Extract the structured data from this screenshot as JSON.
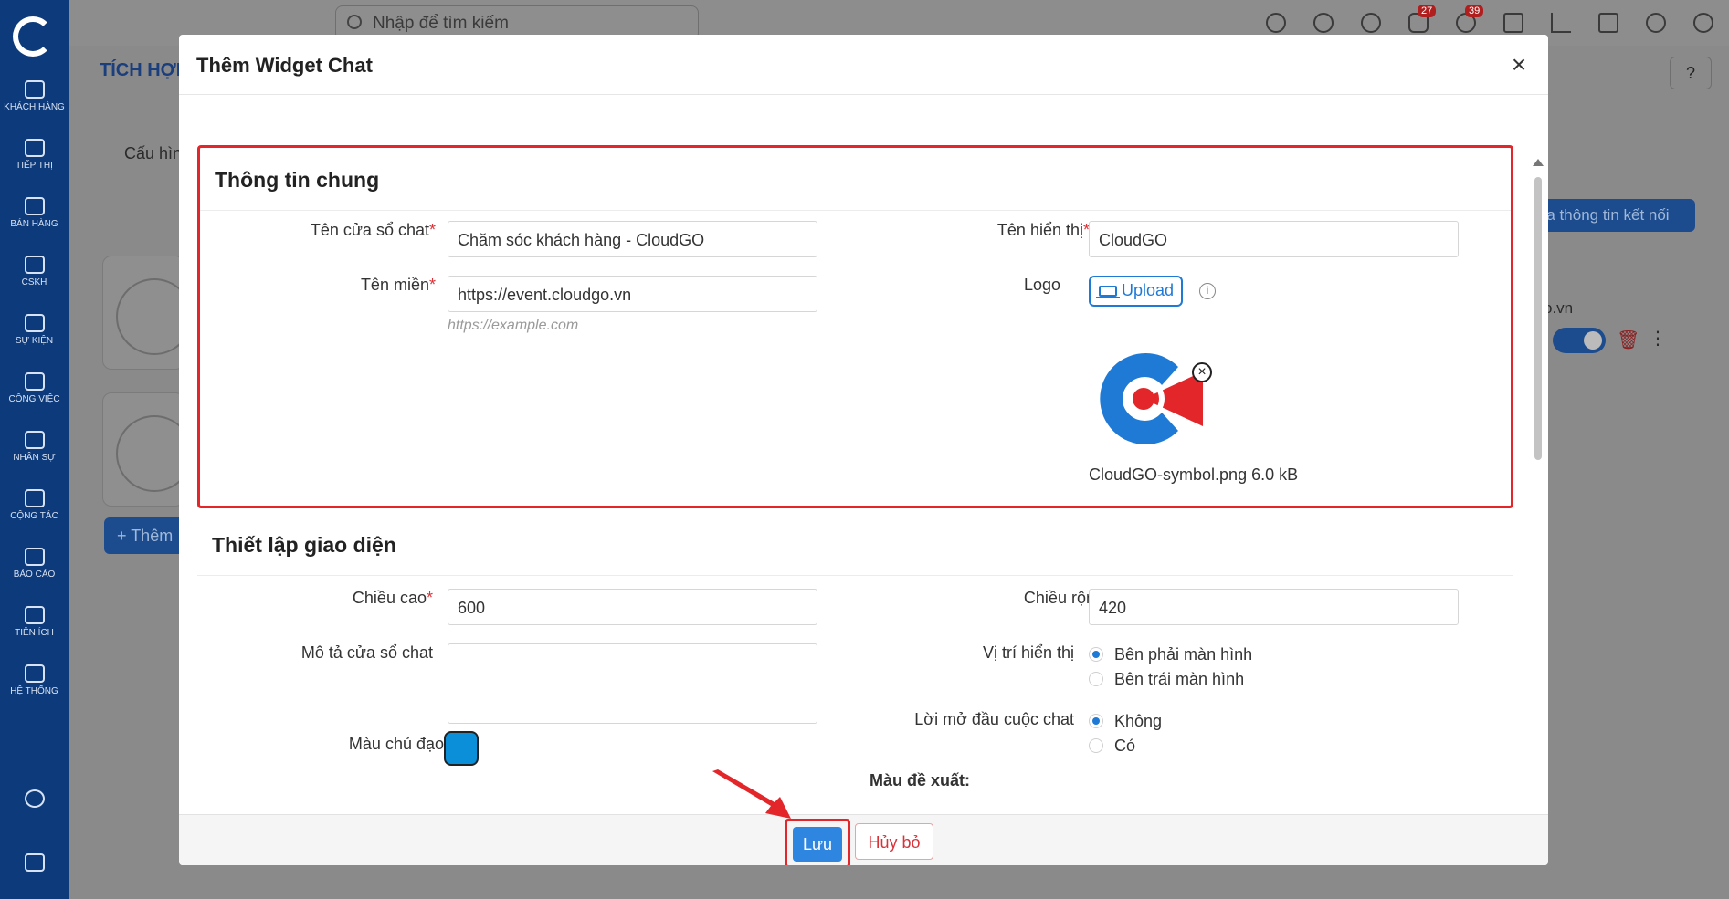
{
  "background": {
    "search_placeholder": "Nhập để tìm kiếm",
    "page_title": "TÍCH HỢP",
    "tab_label": "Cấu hìn",
    "add_button": "+ Thêm",
    "right_button": "ửa thông tin kết nối",
    "right_text": "o.vn",
    "badges": {
      "notifications": "27",
      "messages": "39"
    },
    "sidebar": [
      {
        "label": "KHÁCH HÀNG",
        "icon": "users-icon"
      },
      {
        "label": "TIẾP THỊ",
        "icon": "megaphone-icon"
      },
      {
        "label": "BÁN HÀNG",
        "icon": "cart-icon"
      },
      {
        "label": "CSKH",
        "icon": "headset-icon"
      },
      {
        "label": "SỰ KIỆN",
        "icon": "calendar-icon"
      },
      {
        "label": "CÔNG VIỆC",
        "icon": "briefcase-icon"
      },
      {
        "label": "NHÂN SỰ",
        "icon": "id-card-icon"
      },
      {
        "label": "CỘNG TÁC",
        "icon": "workflow-icon"
      },
      {
        "label": "BÁO CÁO",
        "icon": "report-icon"
      },
      {
        "label": "TIỆN ÍCH",
        "icon": "layers-icon"
      },
      {
        "label": "HỆ THỐNG",
        "icon": "server-icon"
      }
    ]
  },
  "modal": {
    "title": "Thêm Widget Chat",
    "general": {
      "title": "Thông tin chung",
      "chat_name_label": "Tên cửa sổ chat",
      "chat_name_value": "Chăm sóc khách hàng - CloudGO",
      "display_name_label": "Tên hiển thị",
      "display_name_value": "CloudGO",
      "domain_label": "Tên miền",
      "domain_value": "https://event.cloudgo.vn",
      "domain_hint": "https://example.com",
      "logo_label": "Logo",
      "upload_label": "Upload",
      "file_name": "CloudGO-symbol.png 6.0 kB"
    },
    "appearance": {
      "title": "Thiết lập giao diện",
      "height_label": "Chiều cao",
      "height_value": "600",
      "width_label": "Chiều rộng",
      "width_value": "420",
      "description_label": "Mô tả cửa sổ chat",
      "position_label": "Vị trí hiển thị",
      "position_options": [
        "Bên phải màn hình",
        "Bên trái màn hình"
      ],
      "greeting_label": "Lời mở đầu cuộc chat",
      "greeting_options": [
        "Không",
        "Có"
      ],
      "main_color_label": "Màu chủ đạo",
      "main_color": "#0b8fd8",
      "suggested_label": "Màu đề xuất:",
      "suggested_colors": [
        "#e6e6e6",
        "#fff6cc",
        "#ffe400",
        "#ffa300",
        "#d18a3e",
        "#f47b2b",
        "#ff6546",
        "#e03f5c",
        "#cc5f63",
        "#f48585"
      ]
    },
    "footer": {
      "save": "Lưu",
      "cancel": "Hủy bỏ"
    }
  },
  "colors": {
    "accent": "#1f7ad6",
    "highlight": "#e2262a",
    "sidebar": "#0d3a7a"
  }
}
